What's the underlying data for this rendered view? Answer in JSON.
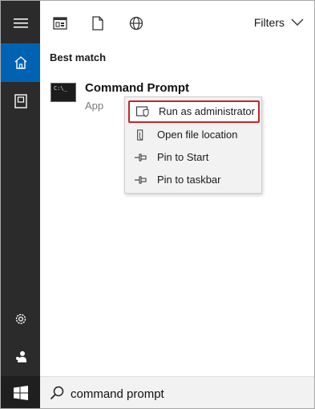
{
  "rail": {
    "items": [
      {
        "name": "hamburger-menu-icon"
      },
      {
        "name": "home-icon",
        "active": true
      },
      {
        "name": "documents-icon"
      },
      {
        "name": "settings-icon"
      },
      {
        "name": "people-icon"
      }
    ],
    "active_color": "#0063b1",
    "background": "#2b2b2b"
  },
  "topbar": {
    "filters_label": "Filters",
    "icons": [
      "apps-icon",
      "document-icon",
      "web-icon"
    ]
  },
  "results": {
    "section_title": "Best match",
    "best_match": {
      "name": "Command Prompt",
      "type": "App",
      "icon_text": "C:\\_"
    }
  },
  "context_menu": {
    "items": [
      {
        "label": "Run as administrator",
        "icon": "shield-icon",
        "highlighted": true
      },
      {
        "label": "Open file location",
        "icon": "file-location-icon"
      },
      {
        "label": "Pin to Start",
        "icon": "pin-icon"
      },
      {
        "label": "Pin to taskbar",
        "icon": "pin-icon"
      }
    ],
    "highlight_color": "#c0272d"
  },
  "search": {
    "value": "command prompt"
  }
}
